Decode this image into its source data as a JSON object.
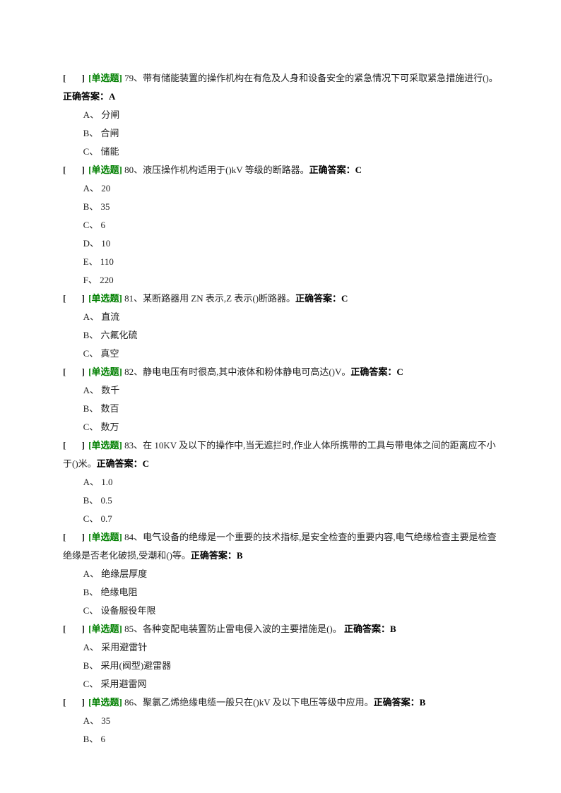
{
  "bracket": "[　 ]",
  "tag": "[单选题]",
  "answerLabel": "正确答案：",
  "questions": [
    {
      "num": "79",
      "text": "带有储能装置的操作机构在有危及人身和设备安全的紧急情况下可采取紧急措施进行()。",
      "answer": "A",
      "options": [
        {
          "letter": "A",
          "text": "分闸"
        },
        {
          "letter": "B",
          "text": "合闸"
        },
        {
          "letter": "C",
          "text": "储能"
        }
      ]
    },
    {
      "num": "80",
      "text": "液压操作机构适用于()kV 等级的断路器。",
      "answer": "C",
      "options": [
        {
          "letter": "A",
          "text": "20"
        },
        {
          "letter": "B",
          "text": "35"
        },
        {
          "letter": "C",
          "text": "6"
        },
        {
          "letter": "D",
          "text": "10"
        },
        {
          "letter": "E",
          "text": "110"
        },
        {
          "letter": "F",
          "text": "220"
        }
      ]
    },
    {
      "num": "81",
      "text": "某断路器用 ZN 表示,Z 表示()断路器。",
      "answer": "C",
      "options": [
        {
          "letter": "A",
          "text": "直流"
        },
        {
          "letter": "B",
          "text": "六氟化硫"
        },
        {
          "letter": "C",
          "text": "真空"
        }
      ]
    },
    {
      "num": "82",
      "text": "静电电压有时很高,其中液体和粉体静电可高达()V。",
      "answer": "C",
      "options": [
        {
          "letter": "A",
          "text": "数千"
        },
        {
          "letter": "B",
          "text": "数百"
        },
        {
          "letter": "C",
          "text": "数万"
        }
      ]
    },
    {
      "num": "83",
      "text": "在 10KV 及以下的操作中,当无遮拦时,作业人体所携带的工具与带电体之间的距离应不小于()米。",
      "answer": "C",
      "options": [
        {
          "letter": "A",
          "text": "1.0"
        },
        {
          "letter": "B",
          "text": "0.5"
        },
        {
          "letter": "C",
          "text": "0.7"
        }
      ]
    },
    {
      "num": "84",
      "text": "电气设备的绝缘是一个重要的技术指标,是安全检查的重要内容,电气绝缘检查主要是检查绝缘是否老化破损,受潮和()等。",
      "answer": "B",
      "options": [
        {
          "letter": "A",
          "text": "绝缘层厚度"
        },
        {
          "letter": "B",
          "text": "绝缘电阻"
        },
        {
          "letter": "C",
          "text": "设备服役年限"
        }
      ]
    },
    {
      "num": "85",
      "text": "各种变配电装置防止雷电侵入波的主要措施是()。 ",
      "answer": "B",
      "options": [
        {
          "letter": "A",
          "text": "采用避雷针"
        },
        {
          "letter": "B",
          "text": "采用(阀型)避雷器"
        },
        {
          "letter": "C",
          "text": "采用避雷网"
        }
      ]
    },
    {
      "num": "86",
      "text": "聚氯乙烯绝缘电缆一般只在()kV 及以下电压等级中应用。",
      "answer": "B",
      "options": [
        {
          "letter": "A",
          "text": "35"
        },
        {
          "letter": "B",
          "text": "6"
        }
      ]
    }
  ]
}
